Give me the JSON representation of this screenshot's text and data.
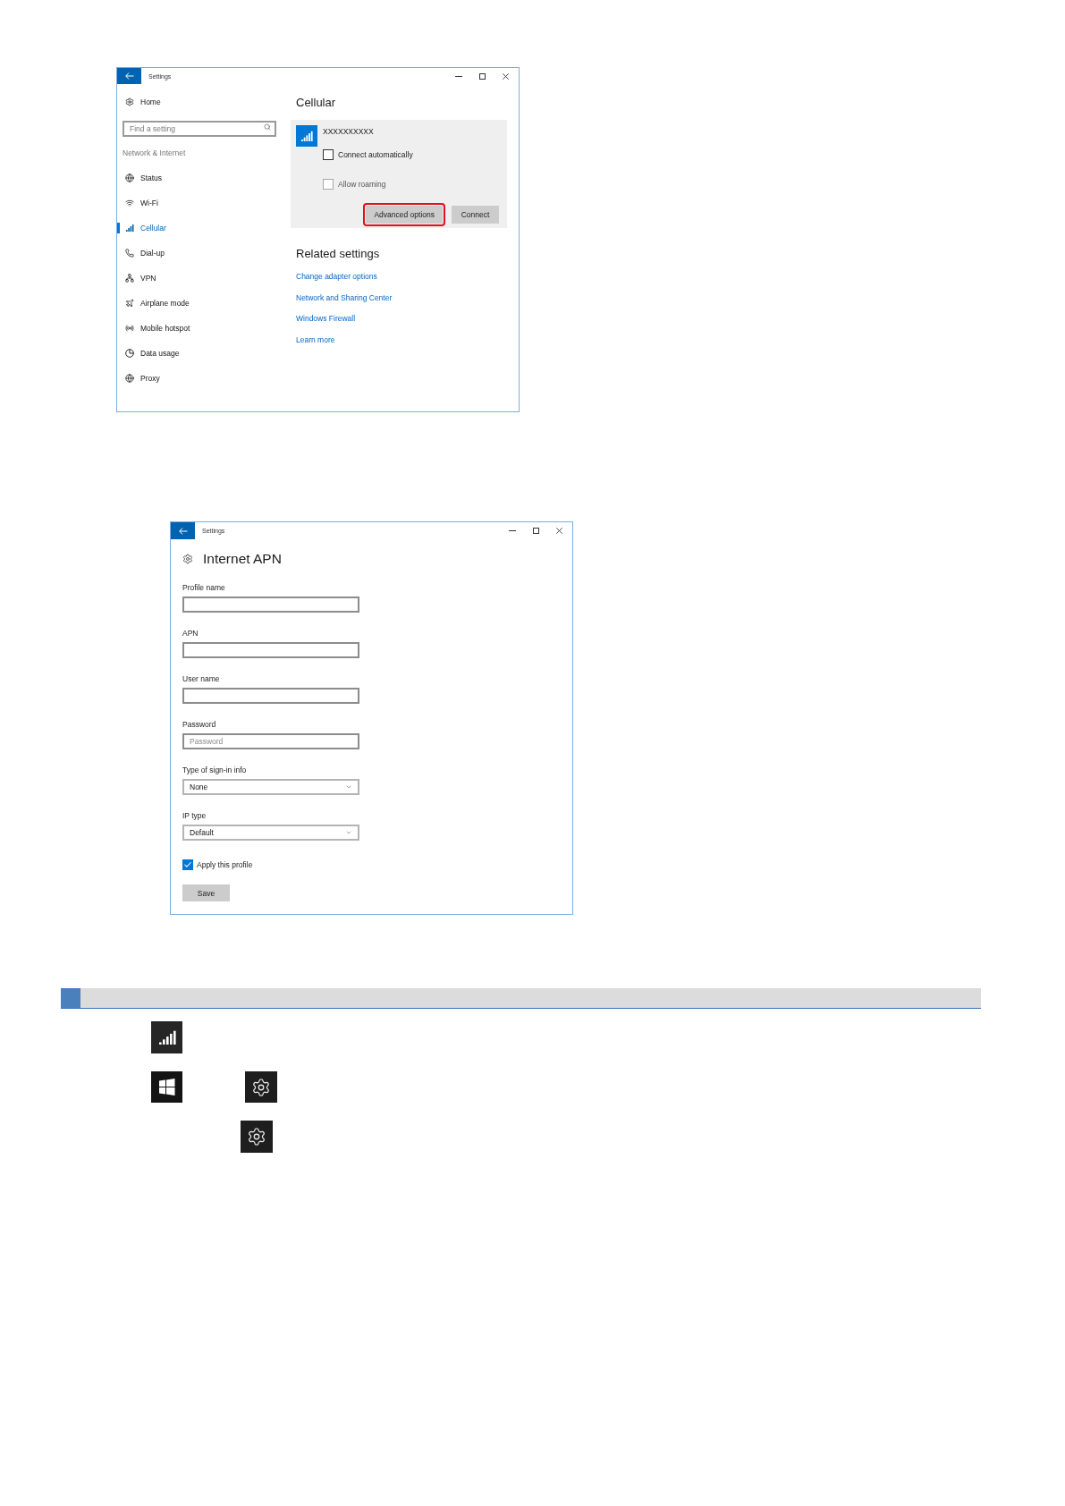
{
  "cellular_window": {
    "title": "Settings",
    "sidebar": {
      "home": "Home",
      "search": {
        "placeholder": "Find a setting"
      },
      "group_label": "Network & Internet",
      "items": [
        {
          "label": "Status",
          "selected": false
        },
        {
          "label": "Wi-Fi",
          "selected": false
        },
        {
          "label": "Cellular",
          "selected": true
        },
        {
          "label": "Dial-up",
          "selected": false
        },
        {
          "label": "VPN",
          "selected": false
        },
        {
          "label": "Airplane mode",
          "selected": false
        },
        {
          "label": "Mobile hotspot",
          "selected": false
        },
        {
          "label": "Data usage",
          "selected": false
        },
        {
          "label": "Proxy",
          "selected": false
        }
      ]
    },
    "content": {
      "title": "Cellular",
      "connection": {
        "name": "XXXXXXXXXX",
        "options": [
          {
            "label": "Connect automatically",
            "checked": false,
            "disabled": false
          },
          {
            "label": "Allow roaming",
            "checked": false,
            "disabled": true
          }
        ],
        "buttons": [
          {
            "label": "Advanced options",
            "highlighted": true
          },
          {
            "label": "Connect",
            "highlighted": false
          }
        ]
      },
      "related": {
        "title": "Related settings",
        "links": [
          "Change adapter options",
          "Network and Sharing Center",
          "Windows Firewall",
          "Learn more"
        ]
      }
    }
  },
  "apn_window": {
    "title": "Settings",
    "heading": "Internet APN",
    "fields": [
      {
        "kind": "text",
        "label": "Profile name"
      },
      {
        "kind": "text",
        "label": "APN"
      },
      {
        "kind": "text",
        "label": "User name"
      },
      {
        "kind": "text",
        "label": "Password",
        "placeholder": "Password"
      },
      {
        "kind": "select",
        "label": "Type of sign-in info",
        "value": "None"
      },
      {
        "kind": "select",
        "label": "IP type",
        "value": "Default"
      }
    ],
    "apply_profile": {
      "label": "Apply this profile",
      "checked": true
    },
    "save_button": "Save"
  }
}
